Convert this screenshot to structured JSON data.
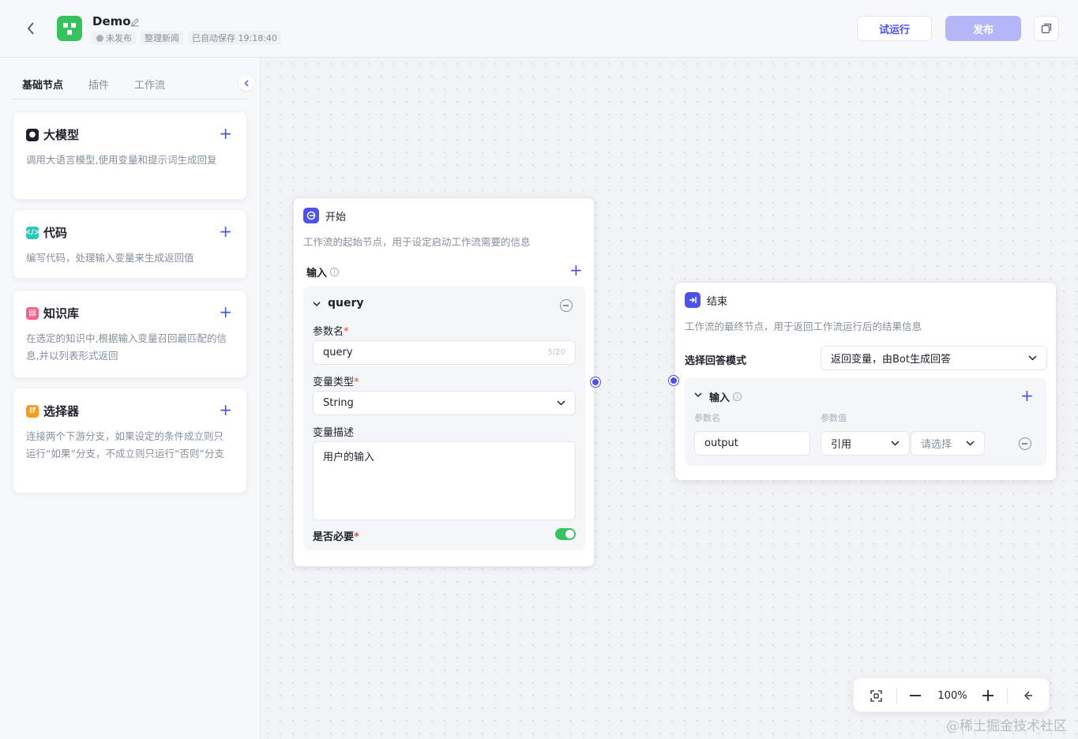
{
  "header": {
    "app_name": "Demo",
    "status": "未发布",
    "tag": "整理新闻",
    "autosave": "已自动保存 19:18:40",
    "run_label": "试运行",
    "publish_label": "发布"
  },
  "sidebar": {
    "tabs": [
      "基础节点",
      "插件",
      "工作流"
    ],
    "cards": [
      {
        "title": "大模型",
        "desc": "调用大语言模型,使用变量和提示词生成回复",
        "icon": "llm-icon",
        "color": "#1d2129"
      },
      {
        "title": "代码",
        "desc": "编写代码，处理输入变量来生成返回值",
        "icon": "code-icon",
        "color": "#2bc7b8"
      },
      {
        "title": "知识库",
        "desc": "在选定的知识中,根据输入变量召回最匹配的信息,并以列表形式返回",
        "icon": "knowledge-icon",
        "color": "#f5658b"
      },
      {
        "title": "选择器",
        "desc": "连接两个下游分支，如果设定的条件成立则只运行“如果”分支，不成立则只运行“否则”分支",
        "icon": "selector-icon",
        "color": "#ff9a1f"
      }
    ]
  },
  "start_node": {
    "title": "开始",
    "desc": "工作流的起始节点，用于设定启动工作流需要的信息",
    "input_label": "输入",
    "param_name": "query",
    "param_name_label": "参数名",
    "param_value": "query",
    "counter": "5/20",
    "type_label": "变量类型",
    "type_value": "String",
    "desc_label": "变量描述",
    "desc_value": "用户的输入",
    "required_label": "是否必要",
    "required": true
  },
  "end_node": {
    "title": "结束",
    "desc": "工作流的最终节点，用于返回工作流运行后的结果信息",
    "mode_label": "选择回答模式",
    "mode_value": "返回变量，由Bot生成回答",
    "input_label": "输入",
    "col_name": "参数名",
    "col_value": "参数值",
    "param_name": "output",
    "ref_type": "引用",
    "ref_placeholder": "请选择"
  },
  "zoom": {
    "level": "100%"
  },
  "watermark": "@稀土掘金技术社区",
  "colors": {
    "accent": "#4d53e8",
    "publish_disabled": "#b4b6f7",
    "logo_green": "#36c25f",
    "toggle_on": "#36c25f"
  }
}
